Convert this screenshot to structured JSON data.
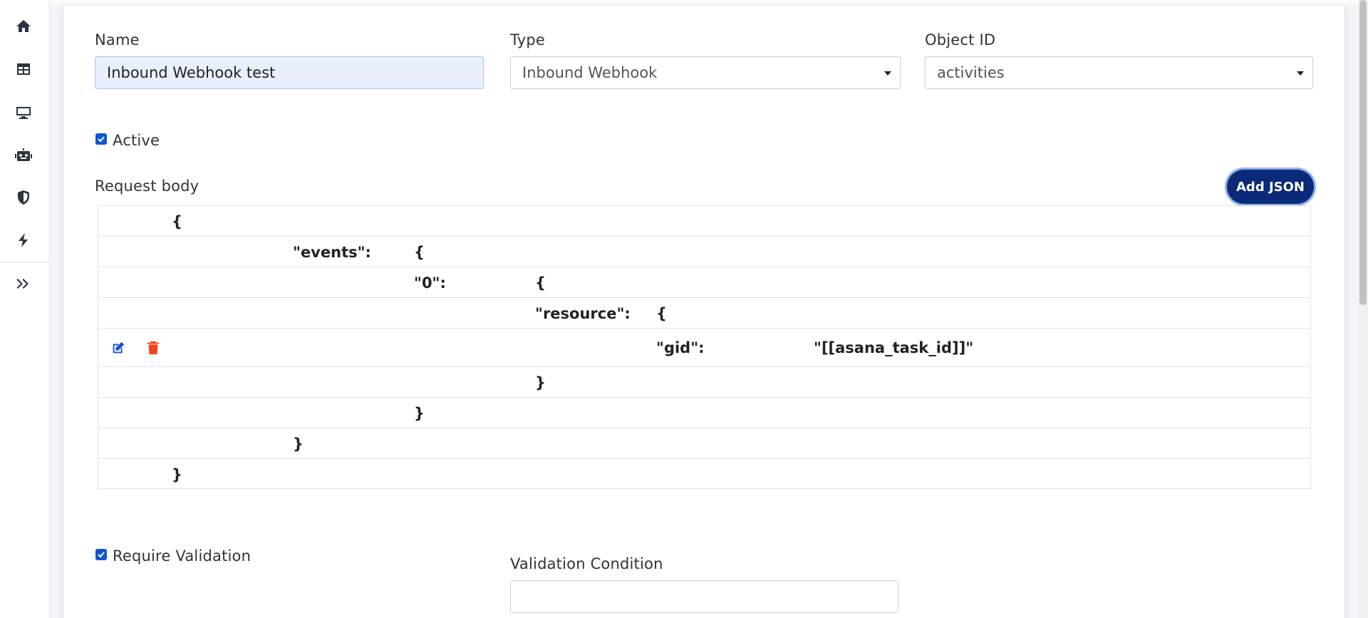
{
  "form": {
    "name_label": "Name",
    "name_value": "Inbound Webhook test",
    "type_label": "Type",
    "type_value": "Inbound Webhook",
    "object_label": "Object ID",
    "object_value": "activities",
    "active_label": "Active",
    "active_checked": true,
    "request_body_label": "Request body",
    "add_json_label": "Add JSON",
    "require_validation_label": "Require Validation",
    "require_validation_checked": true,
    "validation_condition_label": "Validation Condition",
    "validation_condition_value": ""
  },
  "json_rows": [
    {
      "key": "",
      "value": "{"
    },
    {
      "key": "\"events\":",
      "value": "{"
    },
    {
      "key": "\"0\":",
      "value": "{"
    },
    {
      "key": "\"resource\":",
      "value": "{"
    },
    {
      "key": "\"gid\":",
      "value": "\"[[asana_task_id]]\""
    },
    {
      "key": "",
      "value": "}"
    },
    {
      "key": "",
      "value": "}"
    },
    {
      "key": "",
      "value": "}"
    },
    {
      "key": "",
      "value": "}"
    }
  ],
  "sidebar_icons": [
    "home-icon",
    "table-icon",
    "desktop-icon",
    "robot-icon",
    "shield-icon",
    "bolt-icon",
    "expand-chevrons-icon"
  ],
  "colors": {
    "accent": "#0a2a7a",
    "checkbox": "#0b57d0",
    "edit_icon": "#1a4fd6",
    "delete_icon": "#f0441a"
  }
}
